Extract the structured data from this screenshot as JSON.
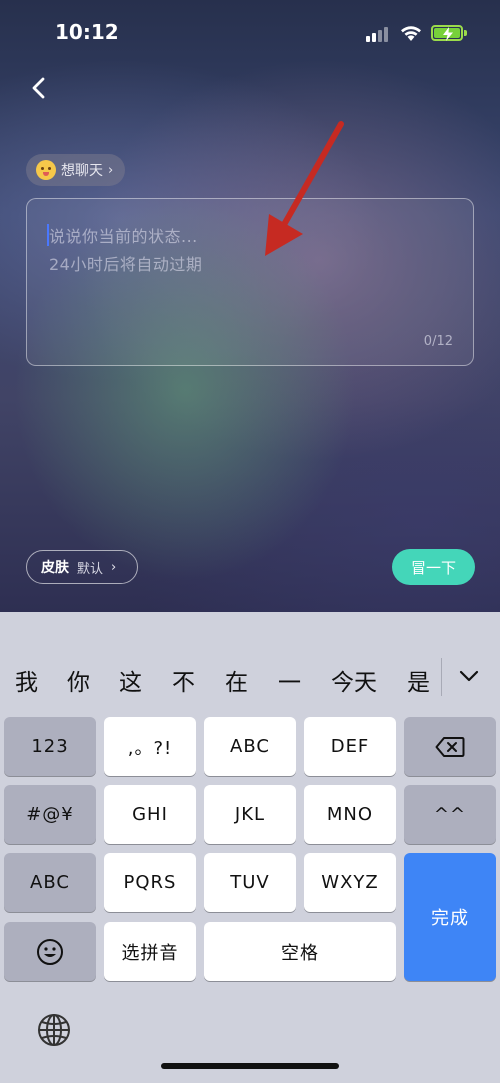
{
  "status_bar": {
    "time": "10:12"
  },
  "header": {
    "back_icon": "chevron-left-icon"
  },
  "mood_chip": {
    "emoji_icon": "smiling-face-icon",
    "label": "想聊天",
    "chevron": "›"
  },
  "status_input": {
    "placeholder_line1": "说说你当前的状态...",
    "placeholder_line2": "24小时后将自动过期",
    "counter": "0/12"
  },
  "skin_button": {
    "label": "皮肤",
    "value": "默认",
    "chevron": "›"
  },
  "submit_button": {
    "label": "冒一下",
    "color": "#44d6b9"
  },
  "annotation": {
    "icon": "red-arrow-icon",
    "color": "#c62a22"
  },
  "keyboard": {
    "candidates": [
      "我",
      "你",
      "这",
      "不",
      "在",
      "一",
      "今天",
      "是"
    ],
    "rows": {
      "r1": [
        "123",
        ",。?!",
        "ABC",
        "DEF"
      ],
      "r2": [
        "#@¥",
        "GHI",
        "JKL",
        "MNO",
        "^^"
      ],
      "r3": [
        "ABC",
        "PQRS",
        "TUV",
        "WXYZ"
      ],
      "r4": [
        "选拼音",
        "空格"
      ]
    },
    "delete_icon": "backspace-icon",
    "emoji_icon": "emoji-face-icon",
    "globe_icon": "globe-icon",
    "done_label": "完成",
    "done_color": "#3e85f6"
  }
}
